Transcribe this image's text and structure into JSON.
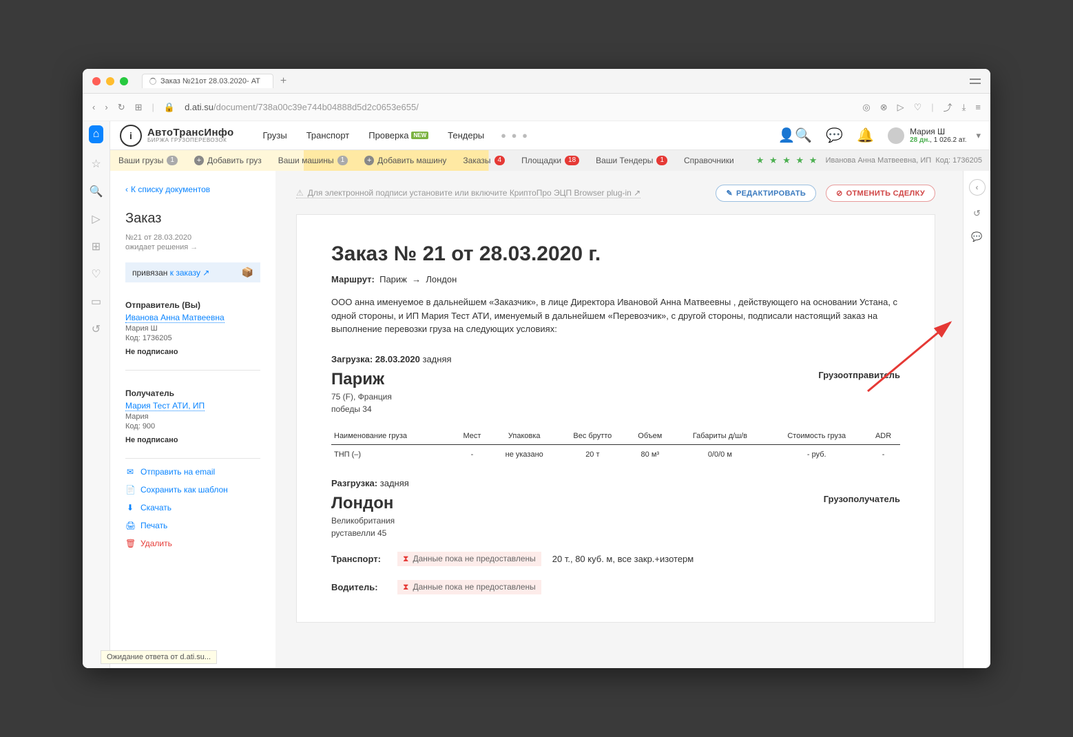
{
  "tab": {
    "title": "Заказ №21от 28.03.2020- АТ"
  },
  "url": {
    "domain": "d.ati.su",
    "path": "/document/738a00c39e744b04888d5d2c0653e655/"
  },
  "logo": {
    "title": "АвтоТрансИнфо",
    "subtitle": "БИРЖА ГРУЗОПЕРЕВОЗОК"
  },
  "nav": {
    "cargo": "Грузы",
    "transport": "Транспорт",
    "check": "Проверка",
    "new": "NEW",
    "tenders": "Тендеры"
  },
  "user": {
    "name": "Мария Ш",
    "days": "28 дн.",
    "balance": "1 026.2 ат."
  },
  "subnav": {
    "your_cargo": "Ваши грузы",
    "cargo_count": "1",
    "add_cargo": "Добавить груз",
    "your_trucks": "Ваши машины",
    "trucks_count": "1",
    "add_truck": "Добавить машину",
    "orders": "Заказы",
    "orders_count": "4",
    "platforms": "Площадки",
    "platforms_count": "18",
    "your_tenders": "Ваши Тендеры",
    "tenders_count": "1",
    "refs": "Справочники",
    "contact_name": "Иванова Анна Матвеевна, ИП",
    "code_label": "Код:",
    "code": "1736205"
  },
  "sidebar": {
    "back": "К списку документов",
    "heading": "Заказ",
    "num_date": "№21 от 28.03.2020",
    "status": "ожидает решения",
    "linked_prefix": "привязан",
    "linked_link": "к заказу ↗",
    "sender_label": "Отправитель (Вы)",
    "sender_name": "Иванова Анна Матвеевна",
    "sender_contact": "Мария Ш",
    "sender_code": "Код: 1736205",
    "not_signed": "Не подписано",
    "recipient_label": "Получатель",
    "recipient_name": "Мария Тест АТИ, ИП",
    "recipient_contact": "Мария",
    "recipient_code": "Код: 900",
    "action_email": "Отправить на email",
    "action_template": "Сохранить как шаблон",
    "action_download": "Скачать",
    "action_print": "Печать",
    "action_delete": "Удалить"
  },
  "alert": {
    "text": "Для электронной подписи установите или включите КриптоПро ЭЦП Browser plug-in ↗"
  },
  "buttons": {
    "edit": "РЕДАКТИРОВАТЬ",
    "cancel": "ОТМЕНИТЬ СДЕЛКУ"
  },
  "doc": {
    "title": "Заказ №  21 от 28.03.2020 г.",
    "route_label": "Маршрут:",
    "route_from": "Париж",
    "route_to": "Лондон",
    "paragraph": "ООО анна именуемое в дальнейшем «Заказчик», в лице Директора Ивановой Анна Матвеевны , действующего на основании Устана, с одной стороны, и ИП Мария Тест АТИ, именуемый в дальнейшем «Перевозчик», с другой стороны, подписали настоящий заказ на выполнение перевозки груза на следующих условиях:",
    "loading_label": "Загрузка:",
    "loading_date": "28.03.2020",
    "loading_type": "задняя",
    "city1": "Париж",
    "addr1a": "75 (F), Франция",
    "addr1b": "победы 34",
    "consigner": "Грузоотправитель",
    "unloading_label": "Разгрузка:",
    "unloading_type": "задняя",
    "city2": "Лондон",
    "addr2a": "Великобритания",
    "addr2b": "руставелли 45",
    "consignee": "Грузополучатель",
    "table": {
      "h_name": "Наименование груза",
      "h_places": "Мест",
      "h_pack": "Упаковка",
      "h_weight": "Вес брутто",
      "h_vol": "Объем",
      "h_dims": "Габариты д/ш/в",
      "h_cost": "Стоимость груза",
      "h_adr": "ADR",
      "r_name": "ТНП (–)",
      "r_places": "-",
      "r_pack": "не указано",
      "r_weight": "20 т",
      "r_vol": "80 м³",
      "r_dims": "0/0/0 м",
      "r_cost": "- руб.",
      "r_adr": "-"
    },
    "transport_label": "Транспорт:",
    "driver_label": "Водитель:",
    "nodata": "Данные пока не предоставлены",
    "transport_spec": "20 т., 80 куб. м, все закр.+изотерм"
  },
  "tooltip": "Ожидание ответа от d.ati.su..."
}
